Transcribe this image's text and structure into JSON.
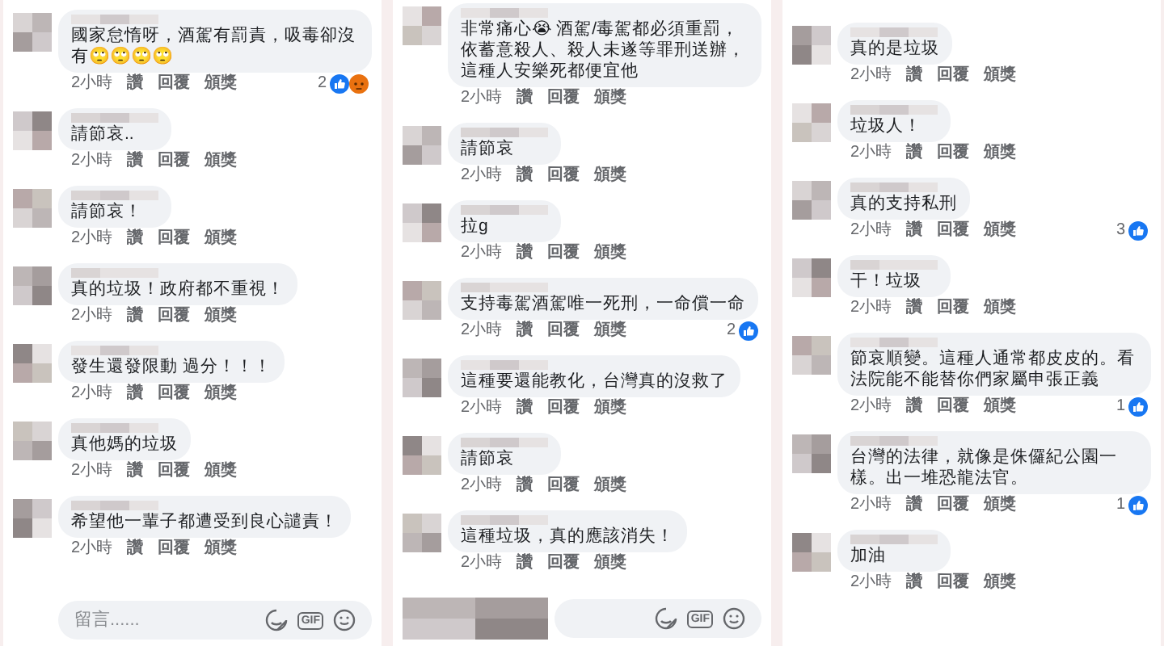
{
  "panels": [
    {
      "comments": [
        {
          "text": "國家怠惰呀，酒駕有罰責，吸毒卻沒有🙄🙄🙄🙄",
          "time": "2小時",
          "actions": [
            "讚",
            "回覆",
            "頒獎"
          ],
          "reactions": {
            "count": "2",
            "like": true,
            "angry": true
          }
        },
        {
          "text": "請節哀..",
          "time": "2小時",
          "actions": [
            "讚",
            "回覆",
            "頒獎"
          ]
        },
        {
          "text": "請節哀！",
          "time": "2小時",
          "actions": [
            "讚",
            "回覆",
            "頒獎"
          ]
        },
        {
          "text": "真的垃圾！政府都不重視！",
          "time": "2小時",
          "actions": [
            "讚",
            "回覆",
            "頒獎"
          ]
        },
        {
          "text": "發生還發限動 過分！！！",
          "time": "2小時",
          "actions": [
            "讚",
            "回覆",
            "頒獎"
          ]
        },
        {
          "text": "真他媽的垃圾",
          "time": "2小時",
          "actions": [
            "讚",
            "回覆",
            "頒獎"
          ]
        },
        {
          "text": "希望他一輩子都遭受到良心譴責！",
          "time": "2小時",
          "actions": [
            "讚",
            "回覆",
            "頒獎"
          ]
        }
      ],
      "composer": {
        "placeholder": "留言......",
        "gif": "GIF"
      }
    },
    {
      "comments": [
        {
          "text": "非常痛心😭 酒駕/毒駕都必須重罰，依蓄意殺人、殺人未遂等罪刑送辦，這種人安樂死都便宜他",
          "time": "2小時",
          "actions": [
            "讚",
            "回覆",
            "頒獎"
          ]
        },
        {
          "text": "請節哀",
          "time": "2小時",
          "actions": [
            "讚",
            "回覆",
            "頒獎"
          ]
        },
        {
          "text": "拉g",
          "time": "2小時",
          "actions": [
            "讚",
            "回覆",
            "頒獎"
          ]
        },
        {
          "text": "支持毒駕酒駕唯一死刑，一命償一命",
          "time": "2小時",
          "actions": [
            "讚",
            "回覆",
            "頒獎"
          ],
          "reactions": {
            "count": "2",
            "like": true,
            "angry": false
          }
        },
        {
          "text": "這種要還能教化，台灣真的沒救了",
          "time": "2小時",
          "actions": [
            "讚",
            "回覆",
            "頒獎"
          ]
        },
        {
          "text": "請節哀",
          "time": "2小時",
          "actions": [
            "讚",
            "回覆",
            "頒獎"
          ]
        },
        {
          "text": "這種垃圾，真的應該消失！",
          "time": "2小時",
          "actions": [
            "讚",
            "回覆",
            "頒獎"
          ]
        }
      ],
      "composer": {
        "gif": "GIF"
      }
    },
    {
      "comments": [
        {
          "text": "真的是垃圾",
          "time": "2小時",
          "actions": [
            "讚",
            "回覆",
            "頒獎"
          ]
        },
        {
          "text": "垃圾人！",
          "time": "2小時",
          "actions": [
            "讚",
            "回覆",
            "頒獎"
          ]
        },
        {
          "text": "真的支持私刑",
          "time": "2小時",
          "actions": [
            "讚",
            "回覆",
            "頒獎"
          ],
          "reactions": {
            "count": "3",
            "like": true,
            "angry": false
          }
        },
        {
          "text": "干！垃圾",
          "time": "2小時",
          "actions": [
            "讚",
            "回覆",
            "頒獎"
          ]
        },
        {
          "text": "節哀順變。這種人通常都皮皮的。看法院能不能替你們家屬申張正義",
          "time": "2小時",
          "actions": [
            "讚",
            "回覆",
            "頒獎"
          ],
          "reactions": {
            "count": "1",
            "like": true,
            "angry": false
          }
        },
        {
          "text": "台灣的法律，就像是侏儸紀公園一樣。出一堆恐龍法官。",
          "time": "2小時",
          "actions": [
            "讚",
            "回覆",
            "頒獎"
          ],
          "reactions": {
            "count": "1",
            "like": true,
            "angry": false
          }
        },
        {
          "text": "加油",
          "time": "2小時",
          "actions": [
            "讚",
            "回覆",
            "頒獎"
          ]
        }
      ]
    }
  ]
}
